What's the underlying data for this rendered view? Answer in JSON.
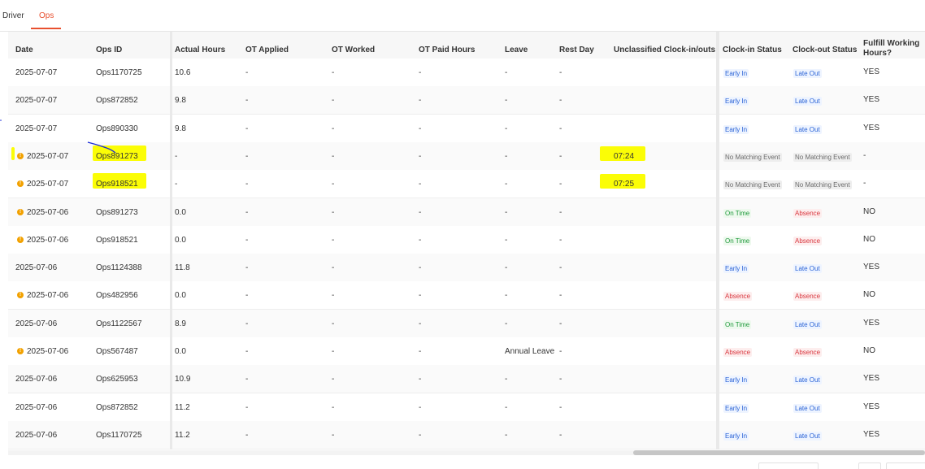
{
  "tabs": [
    {
      "label": "Driver",
      "active": false
    },
    {
      "label": "Ops",
      "active": true
    }
  ],
  "columns": {
    "date": "Date",
    "ops_id": "Ops ID",
    "actual_hours": "Actual Hours",
    "ot_applied": "OT Applied",
    "ot_worked": "OT Worked",
    "ot_paid": "OT Paid Hours",
    "leave": "Leave",
    "rest_day": "Rest Day",
    "unclassified": "Unclassified Clock-in/outs",
    "clock_in": "Clock-in Status",
    "clock_out": "Clock-out Status",
    "fulfill": "Fulfill Working Hours?"
  },
  "rows": [
    {
      "warn": false,
      "date": "2025-07-07",
      "ops_id": "Ops1170725",
      "actual": "10.6",
      "ot_applied": "-",
      "ot_worked": "-",
      "ot_paid": "-",
      "leave": "-",
      "rest": "-",
      "unclassified": "",
      "clock_in": "Early In",
      "clock_out": "Late Out",
      "fulfill": "YES",
      "highlight_id": false,
      "highlight_uncl": false
    },
    {
      "warn": false,
      "date": "2025-07-07",
      "ops_id": "Ops872852",
      "actual": "9.8",
      "ot_applied": "-",
      "ot_worked": "-",
      "ot_paid": "-",
      "leave": "-",
      "rest": "-",
      "unclassified": "",
      "clock_in": "Early In",
      "clock_out": "Late Out",
      "fulfill": "YES",
      "highlight_id": false,
      "highlight_uncl": false
    },
    {
      "warn": false,
      "date": "2025-07-07",
      "ops_id": "Ops890330",
      "actual": "9.8",
      "ot_applied": "-",
      "ot_worked": "-",
      "ot_paid": "-",
      "leave": "-",
      "rest": "-",
      "unclassified": "",
      "clock_in": "Early In",
      "clock_out": "Late Out",
      "fulfill": "YES",
      "highlight_id": false,
      "highlight_uncl": false
    },
    {
      "warn": true,
      "date": "2025-07-07",
      "ops_id": "Ops891273",
      "actual": "-",
      "ot_applied": "-",
      "ot_worked": "-",
      "ot_paid": "-",
      "leave": "-",
      "rest": "-",
      "unclassified": "07:24",
      "clock_in": "No Matching Event",
      "clock_out": "No Matching Event",
      "fulfill": "-",
      "highlight_id": true,
      "highlight_uncl": true
    },
    {
      "warn": true,
      "date": "2025-07-07",
      "ops_id": "Ops918521",
      "actual": "-",
      "ot_applied": "-",
      "ot_worked": "-",
      "ot_paid": "-",
      "leave": "-",
      "rest": "-",
      "unclassified": "07:25",
      "clock_in": "No Matching Event",
      "clock_out": "No Matching Event",
      "fulfill": "-",
      "highlight_id": true,
      "highlight_uncl": true
    },
    {
      "warn": true,
      "date": "2025-07-06",
      "ops_id": "Ops891273",
      "actual": "0.0",
      "ot_applied": "-",
      "ot_worked": "-",
      "ot_paid": "-",
      "leave": "-",
      "rest": "-",
      "unclassified": "",
      "clock_in": "On Time",
      "clock_out": "Absence",
      "fulfill": "NO",
      "highlight_id": false,
      "highlight_uncl": false
    },
    {
      "warn": true,
      "date": "2025-07-06",
      "ops_id": "Ops918521",
      "actual": "0.0",
      "ot_applied": "-",
      "ot_worked": "-",
      "ot_paid": "-",
      "leave": "-",
      "rest": "-",
      "unclassified": "",
      "clock_in": "On Time",
      "clock_out": "Absence",
      "fulfill": "NO",
      "highlight_id": false,
      "highlight_uncl": false
    },
    {
      "warn": false,
      "date": "2025-07-06",
      "ops_id": "Ops1124388",
      "actual": "11.8",
      "ot_applied": "-",
      "ot_worked": "-",
      "ot_paid": "-",
      "leave": "-",
      "rest": "-",
      "unclassified": "",
      "clock_in": "Early In",
      "clock_out": "Late Out",
      "fulfill": "YES",
      "highlight_id": false,
      "highlight_uncl": false
    },
    {
      "warn": true,
      "date": "2025-07-06",
      "ops_id": "Ops482956",
      "actual": "0.0",
      "ot_applied": "-",
      "ot_worked": "-",
      "ot_paid": "-",
      "leave": "-",
      "rest": "-",
      "unclassified": "",
      "clock_in": "Absence",
      "clock_out": "Absence",
      "fulfill": "NO",
      "highlight_id": false,
      "highlight_uncl": false
    },
    {
      "warn": false,
      "date": "2025-07-06",
      "ops_id": "Ops1122567",
      "actual": "8.9",
      "ot_applied": "-",
      "ot_worked": "-",
      "ot_paid": "-",
      "leave": "-",
      "rest": "-",
      "unclassified": "",
      "clock_in": "On Time",
      "clock_out": "Late Out",
      "fulfill": "YES",
      "highlight_id": false,
      "highlight_uncl": false
    },
    {
      "warn": true,
      "date": "2025-07-06",
      "ops_id": "Ops567487",
      "actual": "0.0",
      "ot_applied": "-",
      "ot_worked": "-",
      "ot_paid": "-",
      "leave": "Annual Leave",
      "rest": "-",
      "unclassified": "",
      "clock_in": "Absence",
      "clock_out": "Absence",
      "fulfill": "NO",
      "highlight_id": false,
      "highlight_uncl": false
    },
    {
      "warn": false,
      "date": "2025-07-06",
      "ops_id": "Ops625953",
      "actual": "10.9",
      "ot_applied": "-",
      "ot_worked": "-",
      "ot_paid": "-",
      "leave": "-",
      "rest": "-",
      "unclassified": "",
      "clock_in": "Early In",
      "clock_out": "Late Out",
      "fulfill": "YES",
      "highlight_id": false,
      "highlight_uncl": false
    },
    {
      "warn": false,
      "date": "2025-07-06",
      "ops_id": "Ops872852",
      "actual": "11.2",
      "ot_applied": "-",
      "ot_worked": "-",
      "ot_paid": "-",
      "leave": "-",
      "rest": "-",
      "unclassified": "",
      "clock_in": "Early In",
      "clock_out": "Late Out",
      "fulfill": "YES",
      "highlight_id": false,
      "highlight_uncl": false
    },
    {
      "warn": false,
      "date": "2025-07-06",
      "ops_id": "Ops1170725",
      "actual": "11.2",
      "ot_applied": "-",
      "ot_worked": "-",
      "ot_paid": "-",
      "leave": "-",
      "rest": "-",
      "unclassified": "",
      "clock_in": "Early In",
      "clock_out": "Late Out",
      "fulfill": "YES",
      "highlight_id": false,
      "highlight_uncl": false
    }
  ],
  "status_colors": {
    "Early In": "blue",
    "Late Out": "blue",
    "On Time": "green",
    "Absence": "red",
    "No Matching Event": "gray"
  }
}
